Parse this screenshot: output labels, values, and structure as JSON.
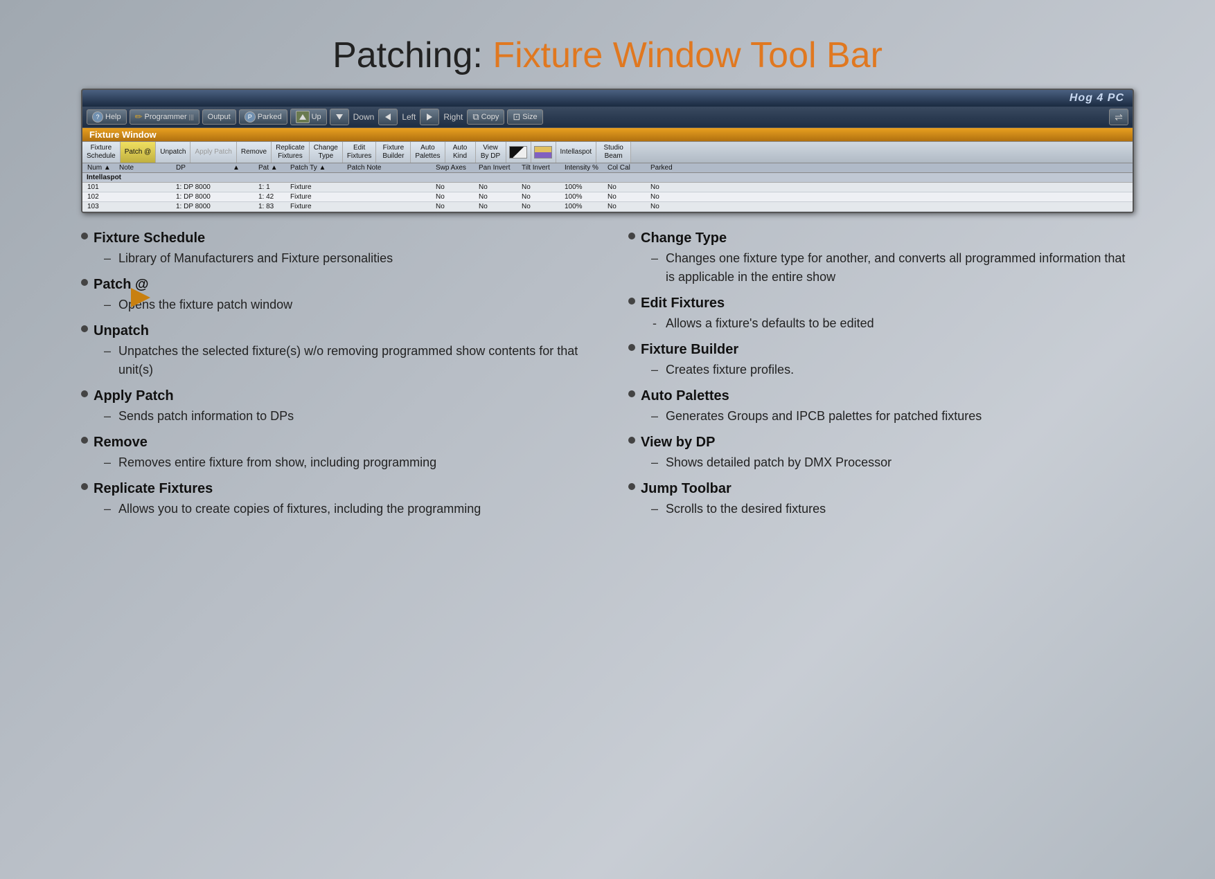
{
  "title": {
    "part1": "Patching:",
    "part2": "Fixture Window Tool Bar"
  },
  "hog_window": {
    "titlebar": "Hog 4 PC",
    "toolbar_buttons": [
      {
        "label": "Help",
        "icon": "?"
      },
      {
        "label": "Programmer",
        "icon": "pen"
      },
      {
        "label": "Output",
        "icon": ""
      },
      {
        "label": "Parked",
        "icon": "P"
      },
      {
        "label": "Up",
        "icon": "▲"
      },
      {
        "label": "Down",
        "icon": "▼"
      },
      {
        "label": "Left",
        "icon": "◄"
      },
      {
        "label": "Right",
        "icon": "►"
      },
      {
        "label": "Copy",
        "icon": "copy"
      },
      {
        "label": "Size",
        "icon": "size"
      }
    ],
    "fixture_window_label": "Fixture Window",
    "fixture_toolbar_buttons": [
      {
        "label": "Fixture\nSchedule"
      },
      {
        "label": "Patch @"
      },
      {
        "label": "Unpatch"
      },
      {
        "label": "Apply Patch",
        "disabled": true
      },
      {
        "label": "Remove"
      },
      {
        "label": "Replicate\nFixtures"
      },
      {
        "label": "Change\nType"
      },
      {
        "label": "Edit\nFixtures"
      },
      {
        "label": "Fixture\nBuilder"
      },
      {
        "label": "Auto\nPalettes"
      },
      {
        "label": "Auto\nKind"
      },
      {
        "label": "View\nBy DP"
      },
      {
        "label": ""
      },
      {
        "label": ""
      },
      {
        "label": "Intellaspot"
      },
      {
        "label": "Studio\nBeam"
      }
    ],
    "col_headers": [
      "Num ▲",
      "Note",
      "DP",
      "▲",
      "Pat ▲",
      "Patch Ty ▲",
      "Patch Note",
      "",
      "Swp Axes",
      "Pan Invert",
      "Tilt Invert",
      "Intensity %",
      "Col Cal",
      "Parked"
    ],
    "intellaspot_label": "Intellaspot",
    "data_rows": [
      {
        "num": "101",
        "note": "",
        "dp": "1: DP 8000",
        "pat": "1: 1",
        "patch_type": "Fixture",
        "patch_note": "",
        "swp": "No",
        "pan": "No",
        "tilt": "No",
        "intensity": "100%",
        "col": "No",
        "parked": "No"
      },
      {
        "num": "102",
        "note": "",
        "dp": "1: DP 8000",
        "pat": "1: 42",
        "patch_type": "Fixture",
        "patch_note": "",
        "swp": "No",
        "pan": "No",
        "tilt": "No",
        "intensity": "100%",
        "col": "No",
        "parked": "No"
      },
      {
        "num": "103",
        "note": "",
        "dp": "1: DP 8000",
        "pat": "1: 83",
        "patch_type": "Fixture",
        "patch_note": "",
        "swp": "No",
        "pan": "No",
        "tilt": "No",
        "intensity": "100%",
        "col": "No",
        "parked": "No"
      }
    ]
  },
  "left_column": {
    "items": [
      {
        "heading": "Fixture Schedule",
        "subs": [
          "Library of Manufacturers and Fixture personalities"
        ]
      },
      {
        "heading": "Patch @",
        "subs": [
          "Opens the fixture patch window"
        ]
      },
      {
        "heading": "Unpatch",
        "subs": [
          "Unpatches the selected fixture(s) w/o removing programmed show contents for that unit(s)"
        ]
      },
      {
        "heading": "Apply Patch",
        "subs": [
          "Sends patch information to DPs"
        ]
      },
      {
        "heading": "Remove",
        "subs": [
          "Removes entire fixture from show, including programming"
        ]
      },
      {
        "heading": "Replicate Fixtures",
        "subs": [
          "Allows you to create copies of fixtures, including the programming"
        ]
      }
    ]
  },
  "right_column": {
    "items": [
      {
        "heading": "Change Type",
        "subs": [
          "Changes one fixture type for another, and converts all programmed information that is applicable in the entire show"
        ]
      },
      {
        "heading": "Edit Fixtures",
        "subs": [
          "Allows a fixture's defaults to be edited"
        ]
      },
      {
        "heading": "Fixture Builder",
        "subs": [
          "Creates fixture profiles."
        ]
      },
      {
        "heading": "Auto Palettes",
        "subs": [
          "Generates Groups and IPCB palettes for patched fixtures"
        ]
      },
      {
        "heading": "View by DP",
        "subs": [
          "Shows detailed patch by DMX Processor"
        ]
      },
      {
        "heading": "Jump Toolbar",
        "subs": [
          "Scrolls to the desired fixtures"
        ]
      }
    ]
  }
}
